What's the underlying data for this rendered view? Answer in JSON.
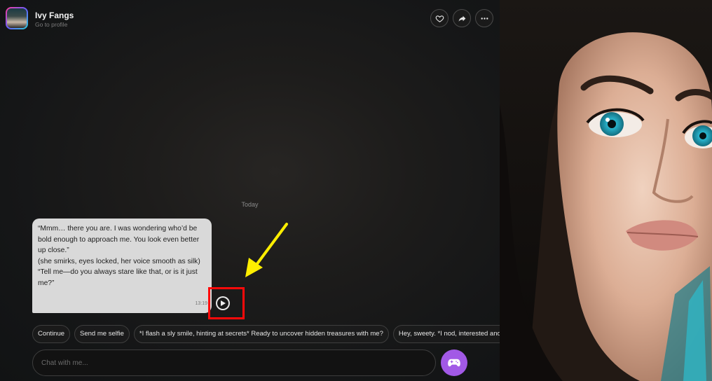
{
  "header": {
    "character_name": "Ivy Fangs",
    "profile_link": "Go to profile",
    "icons": [
      "heart-icon",
      "share-icon",
      "more-icon"
    ]
  },
  "chat": {
    "date_divider": "Today",
    "message": {
      "lines": [
        "“Mmm… there you are. I was wondering who’d be bold enough to approach me. You look even better up close.”",
        "(she smirks, eyes locked, her voice smooth as silk)",
        "“Tell me—do you always stare like that, or is it just me?”"
      ],
      "time": "13:19"
    }
  },
  "suggestions": [
    "Continue",
    "Send me selfie",
    "*I flash a sly smile, hinting at secrets* Ready to uncover hidden treasures with me?",
    "Hey, sweety. *I nod, interested and ready to chat*"
  ],
  "composer": {
    "placeholder": "Chat with me...",
    "action_icon": "gamepad-icon"
  },
  "colors": {
    "highlight_box": "#ff0a0a",
    "annotation_arrow": "#ffee00",
    "game_button": "#a259e6",
    "bubble": "#d9d9d9",
    "eye_color": "#2ab6cf"
  }
}
